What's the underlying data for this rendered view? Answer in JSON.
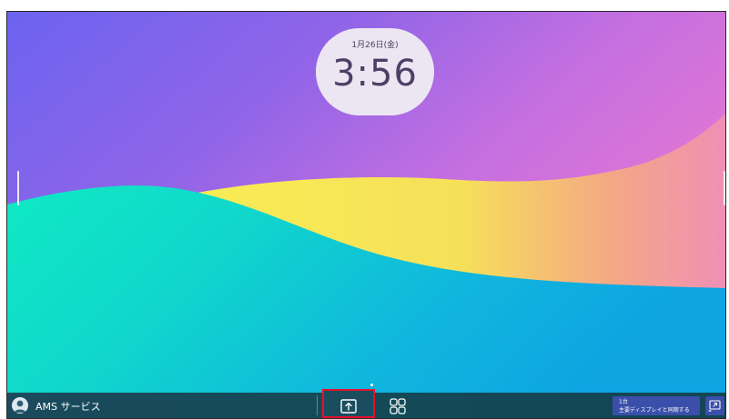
{
  "lock_clock": {
    "date": "1月26日(金)",
    "time": "3:56"
  },
  "taskbar": {
    "user_service_label": "AMS サービス",
    "mirror_panel": {
      "line1": "1台",
      "line2": "主要ディスプレイと同期する"
    }
  },
  "icons": {
    "avatar": "user-avatar-icon",
    "share": "screen-share-icon",
    "apps": "app-grid-icon",
    "cast": "cast-display-icon"
  },
  "colors": {
    "highlight": "#e8102d",
    "taskbar": "#174857",
    "mirror_panel": "#3a4fa9",
    "clock_bg": "#ece6f3"
  }
}
